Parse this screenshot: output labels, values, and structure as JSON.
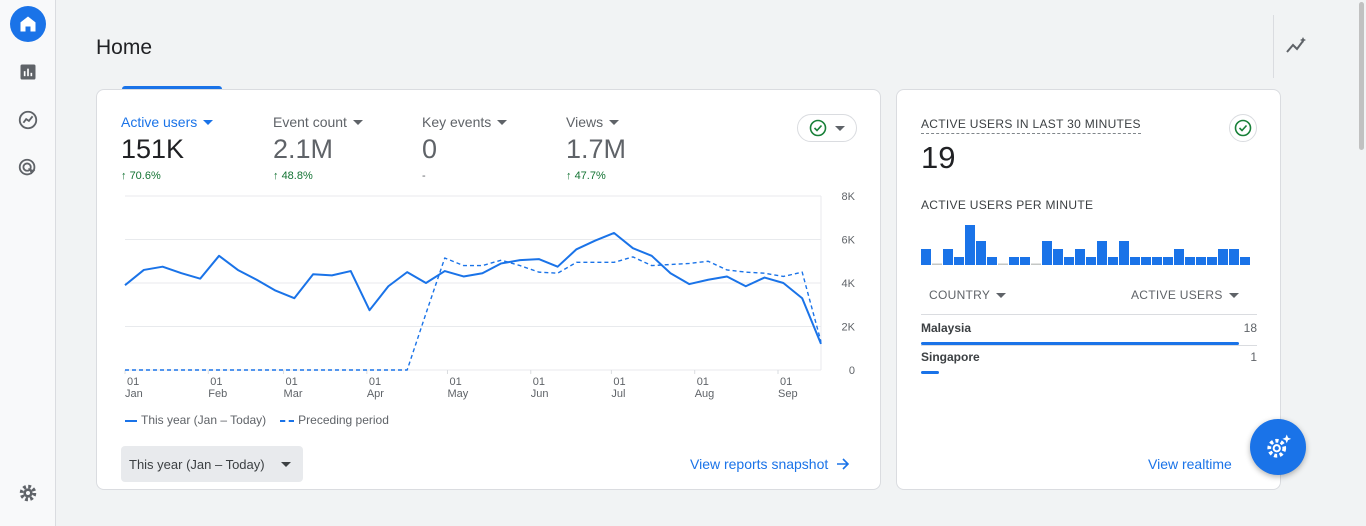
{
  "header": {
    "title": "Home"
  },
  "sidebar": {
    "items": [
      {
        "icon": "home-icon",
        "active": true
      },
      {
        "icon": "reports-icon"
      },
      {
        "icon": "explore-icon"
      },
      {
        "icon": "advertising-icon"
      }
    ],
    "settings_icon": "gear-icon"
  },
  "metrics": [
    {
      "label": "Active users",
      "value": "151K",
      "change": "70.6%",
      "trend": "up",
      "selected": true
    },
    {
      "label": "Event count",
      "value": "2.1M",
      "change": "48.8%",
      "trend": "up"
    },
    {
      "label": "Key events",
      "value": "0",
      "change": "-",
      "trend": "none"
    },
    {
      "label": "Views",
      "value": "1.7M",
      "change": "47.7%",
      "trend": "up"
    }
  ],
  "date_range": "This year (Jan – Today)",
  "view_snapshot": "View reports snapshot",
  "chart_data": {
    "type": "line",
    "x": [
      "Jan 01",
      "Jan 08",
      "Jan 15",
      "Jan 22",
      "Jan 29",
      "Feb 05",
      "Feb 12",
      "Feb 19",
      "Feb 26",
      "Mar 05",
      "Mar 12",
      "Mar 19",
      "Mar 26",
      "Apr 02",
      "Apr 09",
      "Apr 16",
      "Apr 23",
      "Apr 30",
      "May 07",
      "May 14",
      "May 21",
      "May 28",
      "Jun 04",
      "Jun 11",
      "Jun 18",
      "Jun 25",
      "Jul 02",
      "Jul 09",
      "Jul 16",
      "Jul 23",
      "Jul 30",
      "Aug 06",
      "Aug 13",
      "Aug 20",
      "Aug 27",
      "Sep 03",
      "Sep 10",
      "Sep 17"
    ],
    "x_ticks": [
      {
        "day": "01",
        "month": "Jan"
      },
      {
        "day": "01",
        "month": "Feb"
      },
      {
        "day": "01",
        "month": "Mar"
      },
      {
        "day": "01",
        "month": "Apr"
      },
      {
        "day": "01",
        "month": "May"
      },
      {
        "day": "01",
        "month": "Jun"
      },
      {
        "day": "01",
        "month": "Jul"
      },
      {
        "day": "01",
        "month": "Aug"
      },
      {
        "day": "01",
        "month": "Sep"
      }
    ],
    "y_ticks": [
      "0",
      "2K",
      "4K",
      "6K",
      "8K"
    ],
    "ylim": [
      0,
      8000
    ],
    "grid": true,
    "legend_position": "bottom-left",
    "series": [
      {
        "name": "This year (Jan – Today)",
        "style": "solid",
        "values": [
          3900,
          4600,
          4750,
          4450,
          4200,
          5250,
          4600,
          4150,
          3650,
          3300,
          4400,
          4350,
          4550,
          2750,
          3850,
          4500,
          4000,
          4550,
          4300,
          4450,
          4900,
          5050,
          5100,
          4750,
          5550,
          5950,
          6300,
          5600,
          5250,
          4450,
          3950,
          4150,
          4300,
          3850,
          4250,
          4000,
          3300,
          1200
        ]
      },
      {
        "name": "Preceding period",
        "style": "dashed",
        "values": [
          0,
          0,
          0,
          0,
          0,
          0,
          0,
          0,
          0,
          0,
          0,
          0,
          0,
          0,
          0,
          0,
          2600,
          5150,
          4800,
          4800,
          5050,
          4800,
          4500,
          4450,
          4950,
          4950,
          4950,
          5200,
          4800,
          4850,
          4900,
          5000,
          4600,
          4500,
          4450,
          4300,
          4500,
          1300
        ]
      }
    ]
  },
  "realtime": {
    "title": "ACTIVE USERS IN LAST 30 MINUTES",
    "value": "19",
    "per_minute_label": "ACTIVE USERS PER MINUTE",
    "per_minute": [
      2,
      0,
      2,
      1,
      5,
      3,
      1,
      0,
      1,
      1,
      0,
      3,
      2,
      1,
      2,
      1,
      3,
      1,
      3,
      1,
      1,
      1,
      1,
      2,
      1,
      1,
      1,
      2,
      2,
      1
    ],
    "col_country": "COUNTRY",
    "col_users": "ACTIVE USERS",
    "rows": [
      {
        "country": "Malaysia",
        "users": "18",
        "share": 0.947
      },
      {
        "country": "Singapore",
        "users": "1",
        "share": 0.053
      }
    ],
    "view_realtime": "View realtime"
  },
  "colors": {
    "accent": "#1a73e8",
    "positive": "#137333",
    "check": "#188038"
  }
}
